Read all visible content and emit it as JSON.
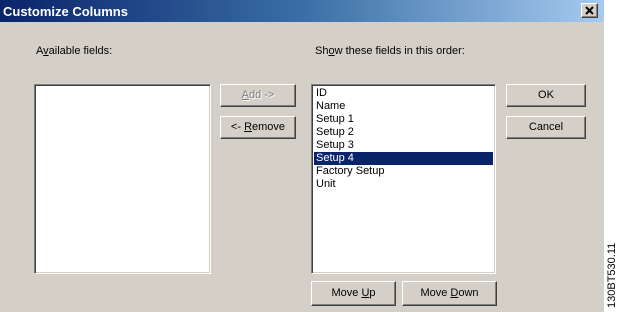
{
  "window": {
    "title": "Customize Columns",
    "close_glyph": "×"
  },
  "available": {
    "label_pre": "A",
    "label_mnemonic": "v",
    "label_post": "ailable fields:",
    "items": []
  },
  "shown": {
    "label_pre": "Sh",
    "label_mnemonic": "o",
    "label_post": "w these fields in this order:",
    "items": [
      "ID",
      "Name",
      "Setup 1",
      "Setup 2",
      "Setup 3",
      "Setup 4",
      "Factory Setup",
      "Unit"
    ],
    "selected_index": 5
  },
  "buttons": {
    "add_pre": "",
    "add_mnemonic": "A",
    "add_post": "dd ->",
    "remove_pre": "<- ",
    "remove_mnemonic": "R",
    "remove_post": "emove",
    "ok": "OK",
    "cancel": "Cancel",
    "move_up_pre": "Move ",
    "move_up_mnemonic": "U",
    "move_up_post": "p",
    "move_down_pre": "Move ",
    "move_down_mnemonic": "D",
    "move_down_post": "own"
  },
  "side_note": "130BT530.11",
  "colors": {
    "dialog_bg": "#d4d0c8",
    "title_start": "#0a246a",
    "title_end": "#a6caf0",
    "selection": "#0a246a"
  }
}
